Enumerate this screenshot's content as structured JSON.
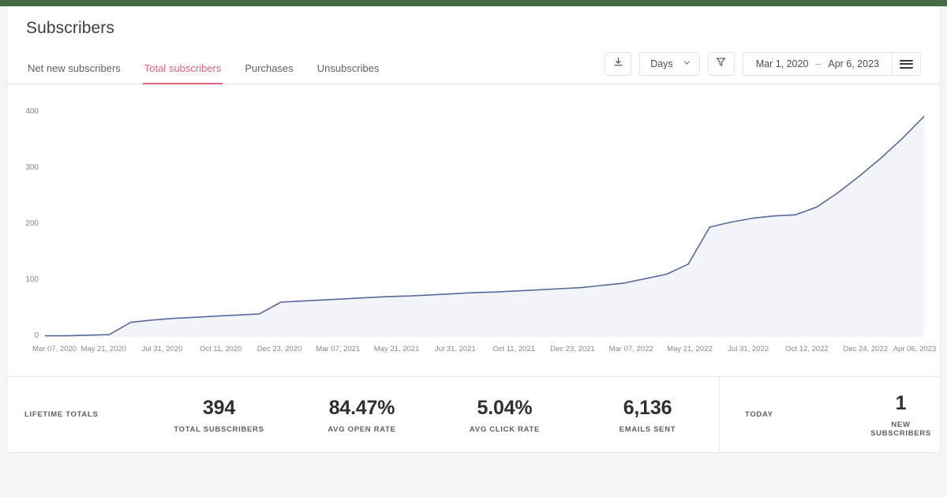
{
  "theme": {
    "top_bar_color": "#476b47",
    "accent_color": "#e4637a",
    "line_color": "#586a9c",
    "area_fill_color": "#f3f4f8",
    "text_color": "#3c4043"
  },
  "header": {
    "title": "Subscribers",
    "tabs": [
      {
        "label": "Net new subscribers",
        "active": false
      },
      {
        "label": "Total subscribers",
        "active": true
      },
      {
        "label": "Purchases",
        "active": false
      },
      {
        "label": "Unsubscribes",
        "active": false
      }
    ]
  },
  "toolbar": {
    "download_icon": "download-icon",
    "interval": {
      "label": "Days",
      "chevron": "chevron-down-icon"
    },
    "filter_icon": "funnel-filter-icon",
    "date_range": {
      "start": "Mar 1, 2020",
      "separator": "–",
      "end": "Apr 6, 2023"
    },
    "menu_icon": "hamburger-menu-icon"
  },
  "chart_data": {
    "type": "area",
    "title": "Total subscribers",
    "xlabel": "",
    "ylabel": "",
    "grid": false,
    "legend": null,
    "ylim": [
      0,
      420
    ],
    "yticks": [
      0,
      100,
      200,
      300,
      400
    ],
    "xticks": [
      "Mar 07, 2020",
      "May 21, 2020",
      "Jul 31, 2020",
      "Oct 11, 2020",
      "Dec 23, 2020",
      "Mar 07, 2021",
      "May 21, 2021",
      "Jul 31, 2021",
      "Oct 11, 2021",
      "Dec 23, 2021",
      "Mar 07, 2022",
      "May 21, 2022",
      "Jul 31, 2022",
      "Oct 12, 2022",
      "Dec 24, 2022",
      "Apr 06, 2023"
    ],
    "series": [
      {
        "name": "Total subscribers",
        "x": [
          "Mar 07, 2020",
          "Apr 14, 2020",
          "May 10, 2020",
          "May 18, 2020",
          "May 21, 2020",
          "Jun 15, 2020",
          "Jul 31, 2020",
          "Sep 05, 2020",
          "Oct 11, 2020",
          "Nov 15, 2020",
          "Dec 23, 2020",
          "Dec 28, 2020",
          "Jan 20, 2021",
          "Mar 07, 2021",
          "Apr 12, 2021",
          "May 21, 2021",
          "Jun 25, 2021",
          "Jul 31, 2021",
          "Sep 05, 2021",
          "Oct 11, 2021",
          "Nov 15, 2021",
          "Dec 23, 2021",
          "Jan 25, 2022",
          "Mar 07, 2022",
          "Apr 12, 2022",
          "May 21, 2022",
          "Jun 25, 2022",
          "Jul 31, 2022",
          "Aug 25, 2022",
          "Sep 15, 2022",
          "Oct 12, 2022",
          "Oct 22, 2022",
          "Nov 05, 2022",
          "Nov 20, 2022",
          "Dec 05, 2022",
          "Dec 24, 2022",
          "Jan 10, 2023",
          "Feb 01, 2023",
          "Feb 20, 2023",
          "Mar 10, 2023",
          "Mar 25, 2023",
          "Apr 06, 2023"
        ],
        "values": [
          2,
          2,
          3,
          4,
          26,
          30,
          33,
          35,
          37,
          39,
          41,
          62,
          64,
          66,
          68,
          70,
          72,
          73,
          75,
          77,
          79,
          80,
          82,
          84,
          86,
          88,
          92,
          96,
          104,
          112,
          130,
          196,
          205,
          212,
          216,
          218,
          232,
          258,
          288,
          320,
          355,
          394
        ]
      }
    ]
  },
  "stats": {
    "lifetime": {
      "group_label": "LIFETIME TOTALS",
      "items": [
        {
          "value": "394",
          "label": "TOTAL SUBSCRIBERS"
        },
        {
          "value": "84.47%",
          "label": "AVG OPEN RATE"
        },
        {
          "value": "5.04%",
          "label": "AVG CLICK RATE"
        },
        {
          "value": "6,136",
          "label": "EMAILS SENT"
        }
      ]
    },
    "today": {
      "group_label": "TODAY",
      "items": [
        {
          "value": "1",
          "label": "NEW SUBSCRIBERS"
        }
      ]
    }
  }
}
